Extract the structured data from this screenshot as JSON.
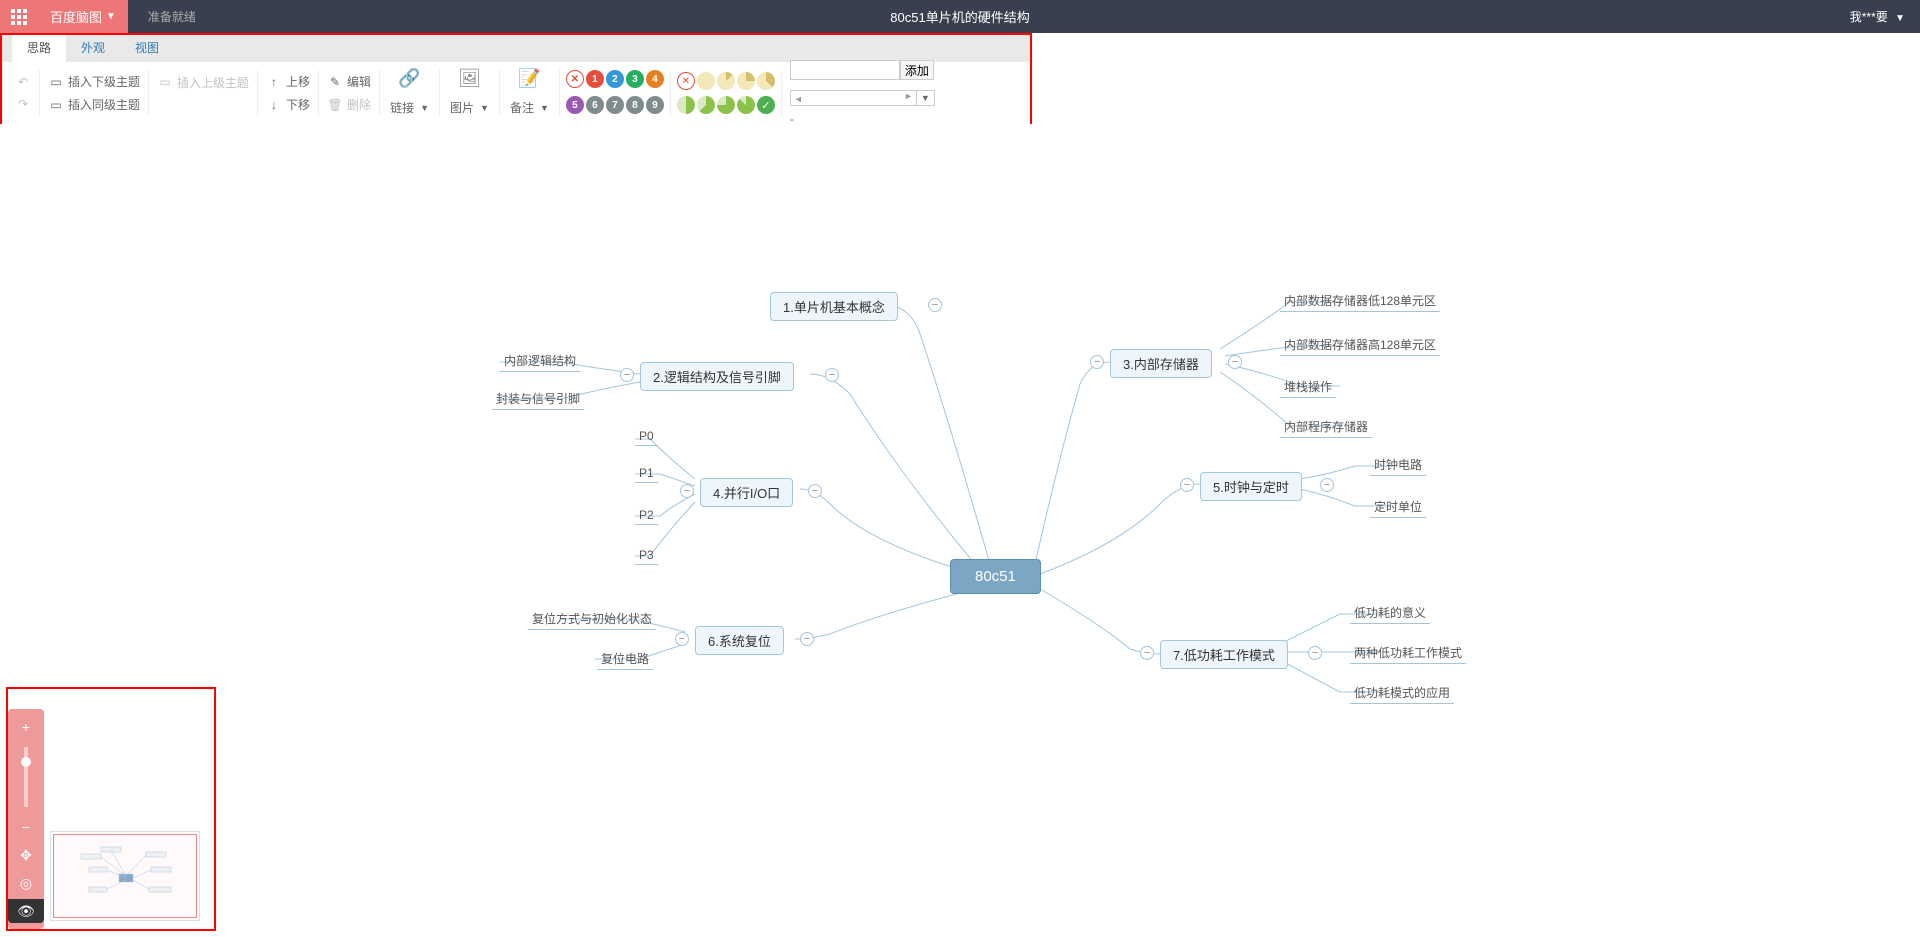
{
  "header": {
    "brand": "百度脑图",
    "status": "准备就绪",
    "title": "80c51单片机的硬件结构",
    "user": "我***要"
  },
  "tabs": [
    {
      "label": "思路",
      "active": true
    },
    {
      "label": "外观",
      "active": false
    },
    {
      "label": "视图",
      "active": false
    }
  ],
  "toolbar": {
    "undo": "",
    "redo": "",
    "insert_child": "插入下级主题",
    "insert_sibling": "插入同级主题",
    "insert_parent": "插入上级主题",
    "move_up": "上移",
    "move_down": "下移",
    "edit": "编辑",
    "delete": "删除",
    "link": "链接",
    "image": "图片",
    "note": "备注",
    "priority_nums": [
      "1",
      "2",
      "3",
      "4",
      "5",
      "6",
      "7",
      "8",
      "9"
    ],
    "priority_colors": [
      "#e74c3c",
      "#e67e22",
      "#3498db",
      "#27ae60",
      "#e67e22",
      "#9b59b6",
      "#7f8c8d",
      "#7f8c8d",
      "#7f8c8d",
      "#7f8c8d"
    ],
    "tag_add": "添加"
  },
  "mindmap": {
    "root": "80c51",
    "branches": [
      {
        "label": "1.单片机基本概念",
        "side": "top",
        "children": []
      },
      {
        "label": "2.逻辑结构及信号引脚",
        "side": "left",
        "children": [
          "内部逻辑结构",
          "封装与信号引脚"
        ]
      },
      {
        "label": "3.内部存储器",
        "side": "right",
        "children": [
          "内部数据存储器低128单元区",
          "内部数据存储器高128单元区",
          "堆栈操作",
          "内部程序存储器"
        ]
      },
      {
        "label": "4.并行I/O口",
        "side": "left",
        "children": [
          "P0",
          "P1",
          "P2",
          "P3"
        ]
      },
      {
        "label": "5.时钟与定时",
        "side": "right",
        "children": [
          "时钟电路",
          "定时单位"
        ]
      },
      {
        "label": "6.系统复位",
        "side": "left",
        "children": [
          "复位方式与初始化状态",
          "复位电路"
        ]
      },
      {
        "label": "7.低功耗工作模式",
        "side": "right",
        "children": [
          "低功耗的意义",
          "两种低功耗工作模式",
          "低功耗模式的应用"
        ]
      }
    ]
  }
}
